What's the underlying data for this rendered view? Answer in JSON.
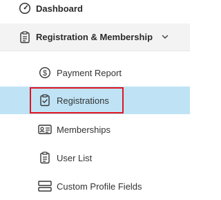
{
  "nav": {
    "dashboard_label": "Dashboard",
    "group": {
      "label": "Registration & Membership",
      "expanded": true
    },
    "items": [
      {
        "label": "Payment Report",
        "icon": "dollar-circle-icon"
      },
      {
        "label": "Registrations",
        "icon": "clipboard-check-icon",
        "active": true
      },
      {
        "label": "Memberships",
        "icon": "id-card-icon"
      },
      {
        "label": "User List",
        "icon": "clipboard-list-icon"
      },
      {
        "label": "Custom Profile Fields",
        "icon": "form-fields-icon"
      }
    ]
  },
  "colors": {
    "active_bg": "#bfe3f5",
    "highlight_border": "#e0141e",
    "group_bg": "#f3f3f3"
  }
}
